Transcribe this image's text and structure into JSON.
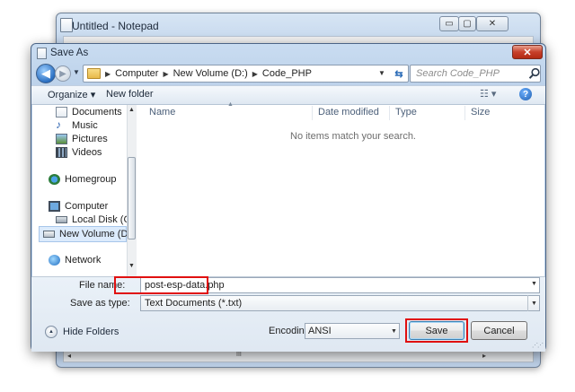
{
  "notepad": {
    "title": "Untitled - Notepad",
    "minimize_glyph": "▭",
    "maximize_glyph": "▢",
    "close_glyph": "✕",
    "scroll_mark": "III"
  },
  "dialog": {
    "title": "Save As",
    "close_glyph": "✕",
    "address": {
      "breadcrumbs": [
        "Computer",
        "New Volume (D:)",
        "Code_PHP"
      ]
    },
    "search_placeholder": "Search Code_PHP",
    "toolbar": {
      "organize_label": "Organize ▾",
      "new_folder_label": "New folder",
      "views_glyph": "☷ ▾",
      "help_glyph": "?"
    },
    "nav_items": [
      {
        "label": "Documents",
        "icon": "documents-icon"
      },
      {
        "label": "Music",
        "icon": "music-icon"
      },
      {
        "label": "Pictures",
        "icon": "pictures-icon"
      },
      {
        "label": "Videos",
        "icon": "videos-icon"
      },
      {
        "label": "Homegroup",
        "icon": "homegroup-icon"
      },
      {
        "label": "Computer",
        "icon": "computer-icon"
      },
      {
        "label": "Local Disk (C:)",
        "icon": "drive-icon"
      },
      {
        "label": "New Volume (D:)",
        "icon": "drive-icon",
        "selected": true
      },
      {
        "label": "Network",
        "icon": "network-icon"
      }
    ],
    "columns": [
      "Name",
      "Date modified",
      "Type",
      "Size"
    ],
    "empty_message": "No items match your search.",
    "file_name_label": "File name:",
    "file_name_value": "post-esp-data.php",
    "save_type_label": "Save as type:",
    "save_type_value": "Text Documents (*.txt)",
    "hide_folders_label": "Hide Folders",
    "encoding_label": "Encoding:",
    "encoding_value": "ANSI",
    "save_label": "Save",
    "cancel_label": "Cancel"
  },
  "colors": {
    "highlight": "#e01010",
    "selection": "#dcebfc",
    "title_glass": "#b9cfe8"
  }
}
